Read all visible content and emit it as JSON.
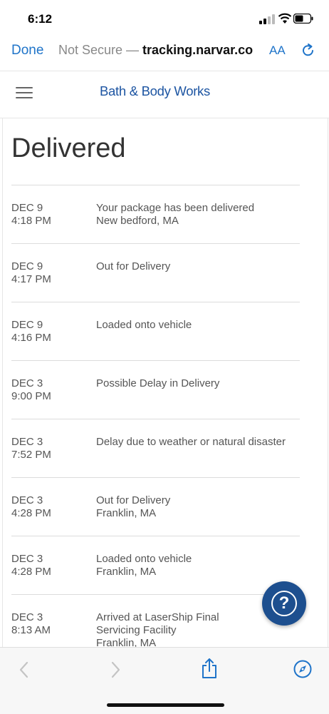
{
  "status_bar": {
    "time": "6:12"
  },
  "browser": {
    "done_label": "Done",
    "url_prefix": "Not Secure — ",
    "url_host": "tracking.narvar.co",
    "text_size_label": "AA"
  },
  "site": {
    "brand": "Bath & Body Works"
  },
  "page": {
    "status_title": "Delivered",
    "events": [
      {
        "date": "DEC 9",
        "time": "4:18 PM",
        "desc": "Your package has been delivered",
        "location": "New bedford, MA"
      },
      {
        "date": "DEC 9",
        "time": "4:17 PM",
        "desc": "Out for Delivery",
        "location": ""
      },
      {
        "date": "DEC 9",
        "time": "4:16 PM",
        "desc": "Loaded onto vehicle",
        "location": ""
      },
      {
        "date": "DEC 3",
        "time": "9:00 PM",
        "desc": "Possible Delay in Delivery",
        "location": ""
      },
      {
        "date": "DEC 3",
        "time": "7:52 PM",
        "desc": "Delay due to weather or natural disaster",
        "location": ""
      },
      {
        "date": "DEC 3",
        "time": "4:28 PM",
        "desc": "Out for Delivery",
        "location": "Franklin, MA"
      },
      {
        "date": "DEC 3",
        "time": "4:28 PM",
        "desc": "Loaded onto vehicle",
        "location": "Franklin, MA"
      },
      {
        "date": "DEC 3",
        "time": "8:13 AM",
        "desc": "Arrived at LaserShip Final Servicing Facility",
        "location": "Franklin, MA"
      }
    ]
  },
  "help": {
    "glyph": "?"
  },
  "icons": {
    "back": "chevron-left-icon",
    "forward": "chevron-right-icon",
    "share": "share-icon",
    "safari": "compass-icon",
    "reload": "reload-icon",
    "menu": "hamburger-menu-icon",
    "help": "help-icon"
  },
  "colors": {
    "link_blue": "#1f74c9",
    "brand_blue": "#1d55a2",
    "help_blue": "#1d4f8f"
  }
}
